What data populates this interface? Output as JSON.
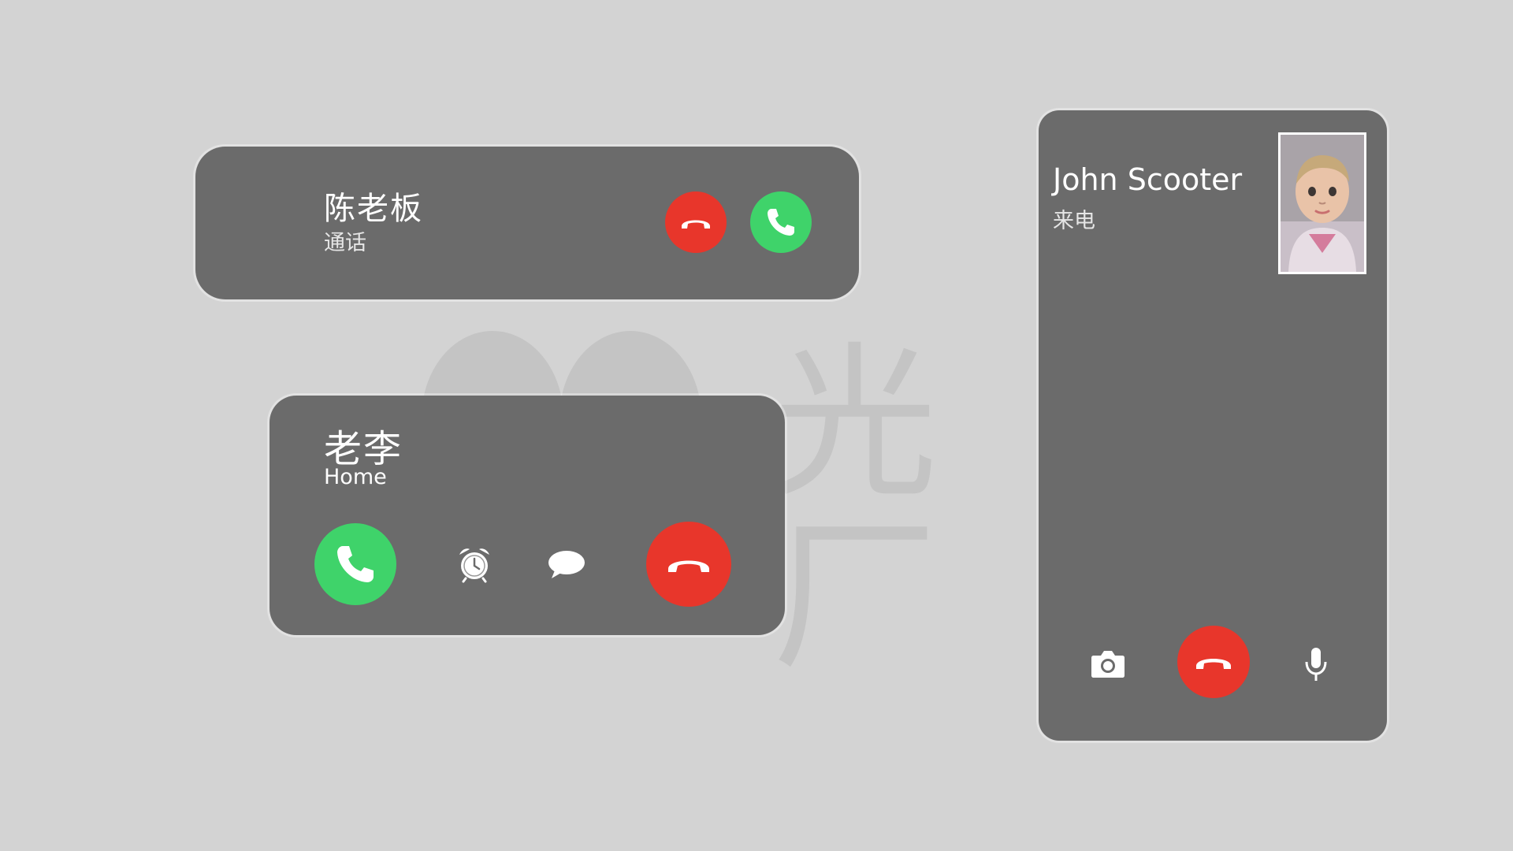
{
  "colors": {
    "background": "#d3d3d3",
    "card": "#6b6b6b",
    "accept_green": "#3fd36a",
    "decline_red": "#e8362b",
    "text_white": "#ffffff"
  },
  "card_1": {
    "caller_name": "陈老板",
    "status": "通话",
    "decline_icon": "phone-hangup-icon",
    "accept_icon": "phone-icon"
  },
  "card_2": {
    "caller_name": "老李",
    "label": "Home",
    "accept_icon": "phone-icon",
    "remind_icon": "alarm-clock-icon",
    "message_icon": "chat-bubble-icon",
    "decline_icon": "phone-hangup-icon"
  },
  "card_3": {
    "caller_name": "John Scooter",
    "status": "来电",
    "photo": "caller-photo",
    "camera_icon": "camera-icon",
    "decline_icon": "phone-hangup-icon",
    "mic_icon": "microphone-icon"
  },
  "watermark": {
    "text": "光厂"
  }
}
